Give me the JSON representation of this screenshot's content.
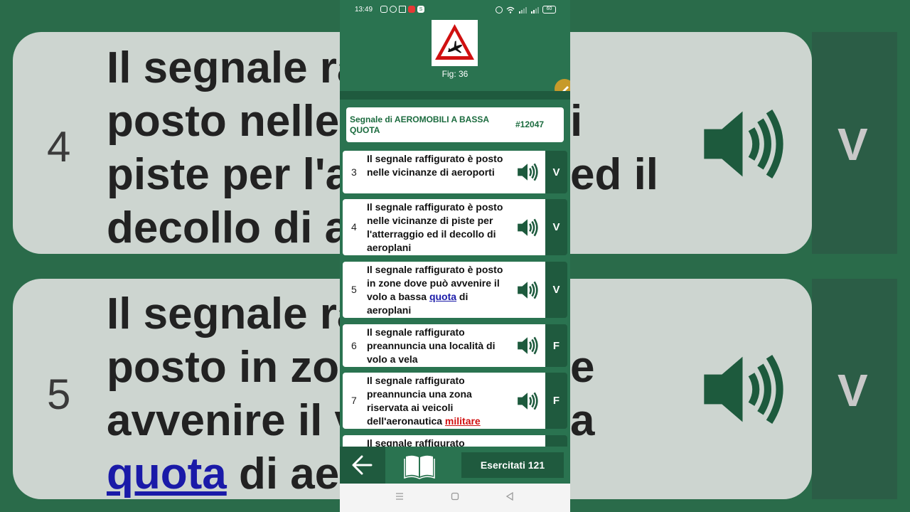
{
  "status_bar": {
    "time": "13:49",
    "battery": "60",
    "notification_badge": "S"
  },
  "header": {
    "fig_label": "Fig: 36"
  },
  "title_card": {
    "title": "Segnale di AEROMOBILI A BASSA QUOTA",
    "code": "#12047"
  },
  "items": [
    {
      "num": "3",
      "text": "Il segnale raffigurato è posto nelle vicinanze di aeroporti",
      "answer": "V"
    },
    {
      "num": "4",
      "text": "Il segnale raffigurato è posto nelle vicinanze di piste per l'atterraggio ed il decollo di aeroplani",
      "answer": "V"
    },
    {
      "num": "5",
      "text_before": "Il segnale raffigurato è posto in zone dove può avvenire il volo a bassa ",
      "link": "quota",
      "text_after": " di aeroplani",
      "answer": "V"
    },
    {
      "num": "6",
      "text": "Il segnale raffigurato preannuncia una località di volo a vela",
      "answer": "F"
    },
    {
      "num": "7",
      "text_before": "Il segnale raffigurato preannuncia una zona riservata ai veicoli dell'aeronautica ",
      "link": "militare",
      "answer": "F"
    },
    {
      "num": "",
      "text": "Il segnale raffigurato",
      "answer": ""
    }
  ],
  "bottom_bar": {
    "exercised_label": "Esercitati 121"
  },
  "background": {
    "card_top_num": "4",
    "card_top_lines": [
      "Il segnale ra",
      "posto nelle",
      "piste per l'a",
      "decollo di a"
    ],
    "card_top_right_fragments": [
      "i",
      "ed il"
    ],
    "card_bottom_num": "5",
    "card_bottom_lines": [
      "Il segnale ra",
      "posto in zon",
      "avvenire il v"
    ],
    "card_bottom_link": "quota",
    "card_bottom_after_link": " di aer",
    "card_bottom_right_fragments": [
      "e",
      "a"
    ],
    "answer_top": "V",
    "answer_bottom": "V"
  },
  "colors": {
    "primary_green": "#2a7350",
    "dark_green": "#1f5a3e",
    "title_green": "#1b6b3e",
    "link_blue": "#1a1aa8",
    "link_red": "#d01010",
    "sign_red": "#d01010"
  }
}
